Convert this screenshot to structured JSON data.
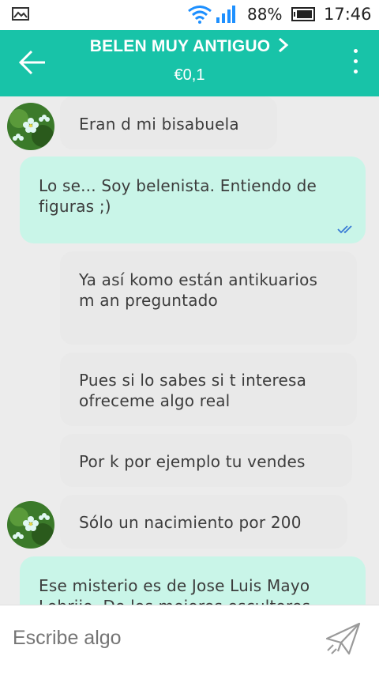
{
  "status_bar": {
    "battery": "88%",
    "time": "17:46",
    "icons": [
      "image-icon",
      "wifi-icon",
      "signal-icon",
      "battery-icon"
    ]
  },
  "header": {
    "title": "BELEN MUY ANTIGUO",
    "price": "€0,1",
    "icons": [
      "back-arrow-icon",
      "chevron-right-icon",
      "more-vert-icon"
    ]
  },
  "messages": [
    {
      "from": "other",
      "text": "Eran d mi bisabuela"
    },
    {
      "from": "me",
      "text": "Lo se... Soy belenista. Entiendo de figuras ;)"
    },
    {
      "from": "other",
      "text": "Ya así komo están antikuarios m an preguntado"
    },
    {
      "from": "other",
      "text": "Pues si lo sabes si t interesa ofreceme algo real"
    },
    {
      "from": "other",
      "text": "Por k por ejemplo tu vendes"
    },
    {
      "from": "other",
      "text": "Sólo un nacimiento por 200"
    },
    {
      "from": "me",
      "text": "Ese misterio es de Jose Luis Mayo Lobrijo. De los mejores escultores"
    }
  ],
  "composer": {
    "placeholder": "Escribe algo",
    "send_icon": "send-icon"
  },
  "colors": {
    "header": "#18c3a8",
    "incoming_bubble": "#e9e9e9",
    "outgoing_bubble": "#c9f5e8",
    "chat_bg": "#ececec"
  }
}
